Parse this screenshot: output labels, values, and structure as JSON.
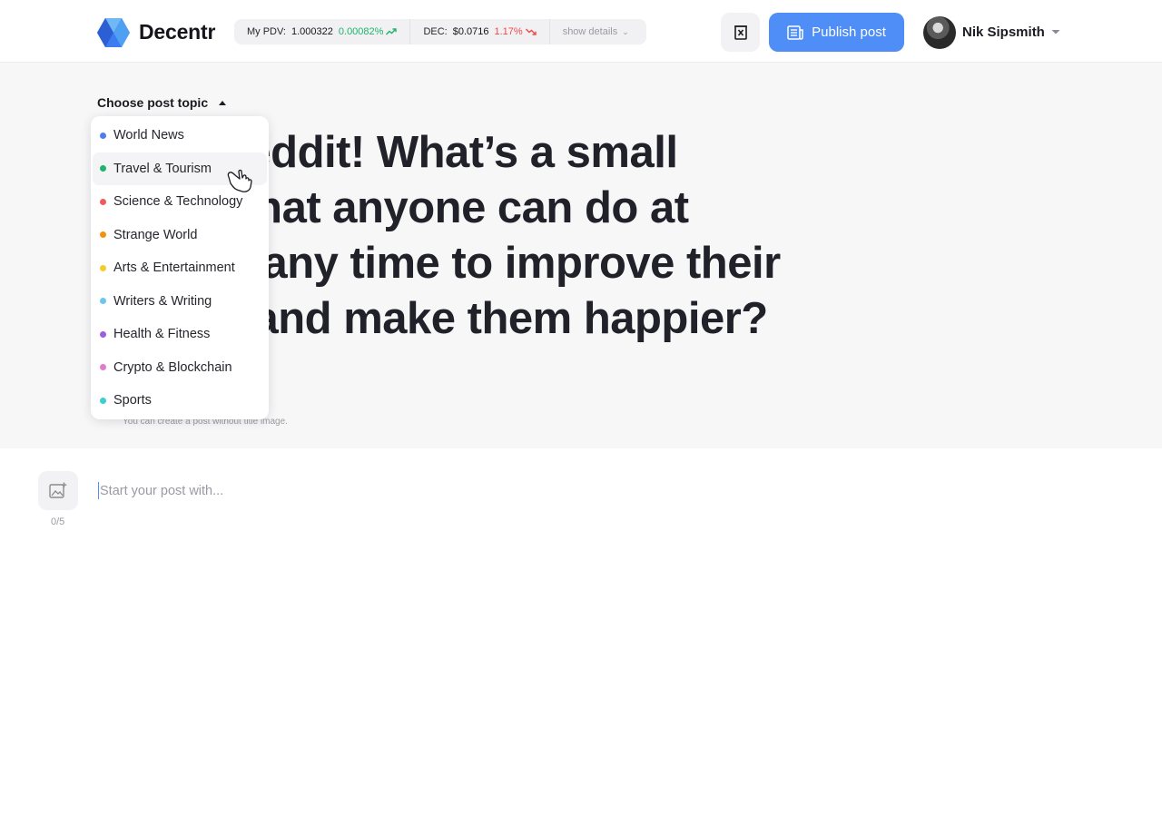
{
  "header": {
    "brand": "Decentr",
    "pdv_label": "My PDV:",
    "pdv_value": "1.000322",
    "pdv_change": "0.00082%",
    "dec_label": "DEC:",
    "dec_value": "$0.0716",
    "dec_change": "1.17%",
    "show_details": "show details",
    "publish_label": "Publish post",
    "user_name": "Nik Sipsmith",
    "colors": {
      "accent": "#4f8df7",
      "up": "#1eb46b",
      "down": "#ef4a4a"
    }
  },
  "topic_picker": {
    "label": "Choose post topic",
    "items": [
      {
        "label": "World News",
        "color": "#4f7df0"
      },
      {
        "label": "Travel & Tourism",
        "color": "#1eb46b"
      },
      {
        "label": "Science & Technology",
        "color": "#ef5b5b"
      },
      {
        "label": "Strange World",
        "color": "#f2930f"
      },
      {
        "label": "Arts & Entertainment",
        "color": "#f5cb2a"
      },
      {
        "label": "Writers & Writing",
        "color": "#6ec6f0"
      },
      {
        "label": "Health & Fitness",
        "color": "#9b5de5"
      },
      {
        "label": "Crypto & Blockchain",
        "color": "#e07bd0"
      },
      {
        "label": "Sports",
        "color": "#3ccfcf"
      }
    ],
    "hovered_index": 1
  },
  "post": {
    "title": "Ask Reddit! What’s a small thing that anyone can do at nearly any time to improve their mood and make them happier?",
    "image_hint": "You can create a post without title image.",
    "body_placeholder": "Start your post with...",
    "image_count": "0/5"
  },
  "icons": {
    "logo": "decentr-logo-icon",
    "delete": "trash-icon",
    "publish": "newspaper-icon",
    "user_menu": "caret-down-icon",
    "add_image": "add-image-icon",
    "cursor": "hand-pointer-icon"
  }
}
